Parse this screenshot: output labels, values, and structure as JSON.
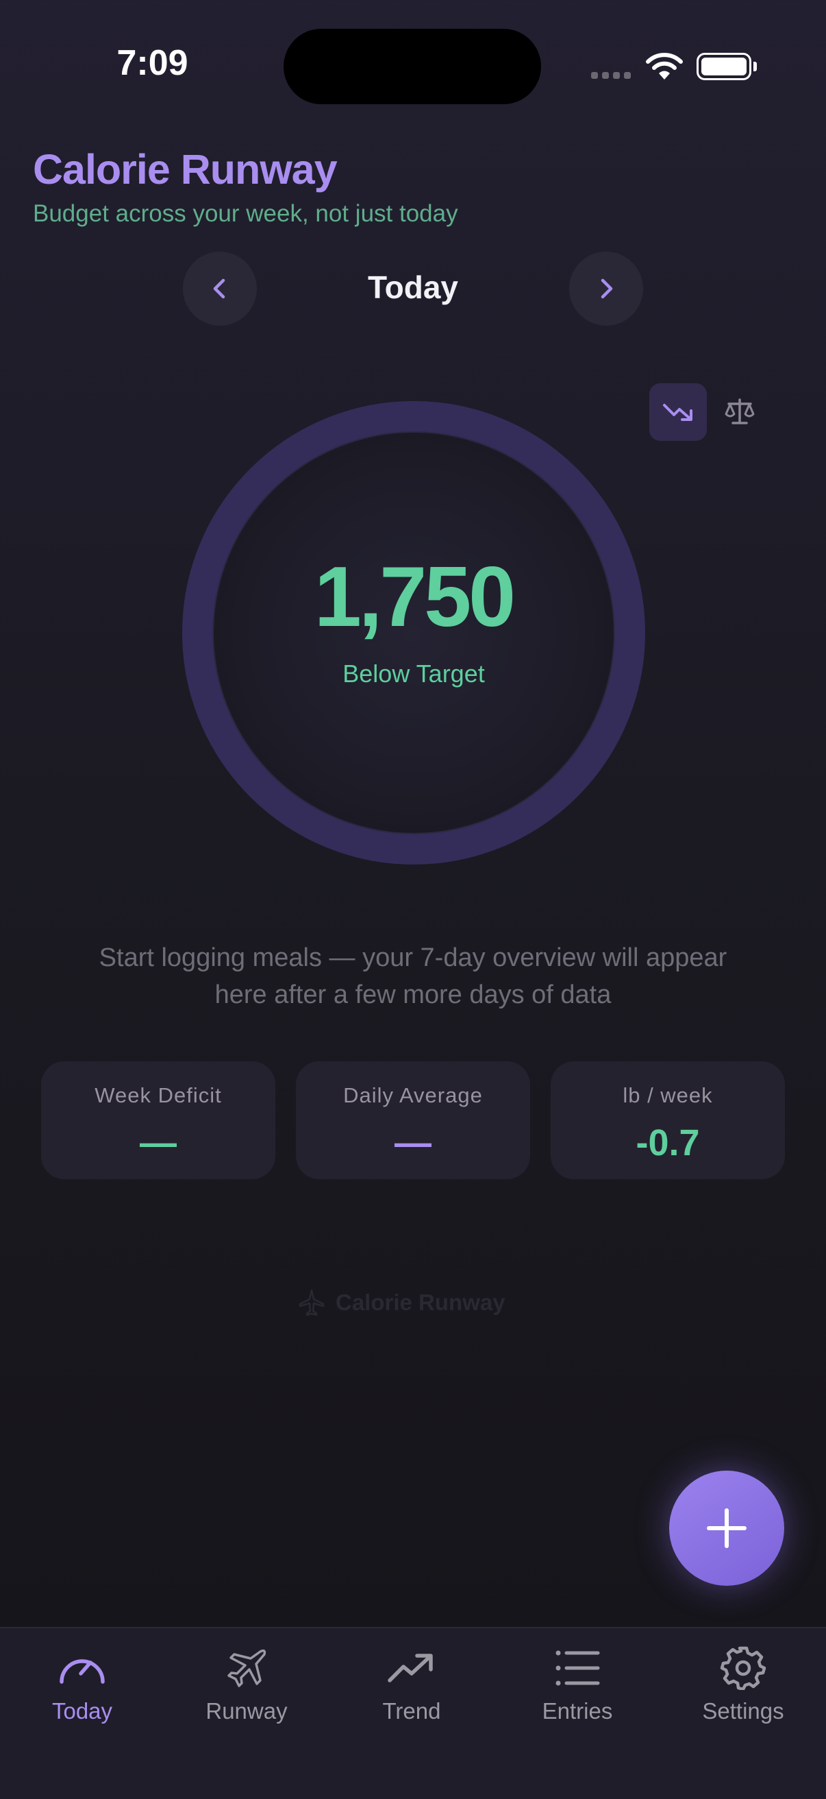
{
  "status_bar": {
    "time": "7:09"
  },
  "header": {
    "title": "Calorie Runway",
    "subtitle": "Budget across your week, not just today"
  },
  "date_nav": {
    "label": "Today"
  },
  "ring": {
    "value": "1,750",
    "label": "Below Target"
  },
  "message": "Start logging meals — your 7-day overview will appear here after a few more days of data",
  "stats": [
    {
      "label": "Week Deficit",
      "value": "—",
      "color": "#5ecf9d"
    },
    {
      "label": "Daily Average",
      "value": "—",
      "color": "#a98ef0"
    },
    {
      "label": "lb / week",
      "value": "-0.7",
      "color": "#5ecf9d"
    }
  ],
  "watermark": "Calorie Runway",
  "tabs": [
    {
      "label": "Today",
      "icon": "gauge-icon",
      "active": true
    },
    {
      "label": "Runway",
      "icon": "airplane-icon",
      "active": false
    },
    {
      "label": "Trend",
      "icon": "trend-up-icon",
      "active": false
    },
    {
      "label": "Entries",
      "icon": "list-icon",
      "active": false
    },
    {
      "label": "Settings",
      "icon": "gear-icon",
      "active": false
    }
  ],
  "colors": {
    "accent": "#a98ef0",
    "positive": "#5ecf9d",
    "subtitle": "#5fae8c"
  }
}
